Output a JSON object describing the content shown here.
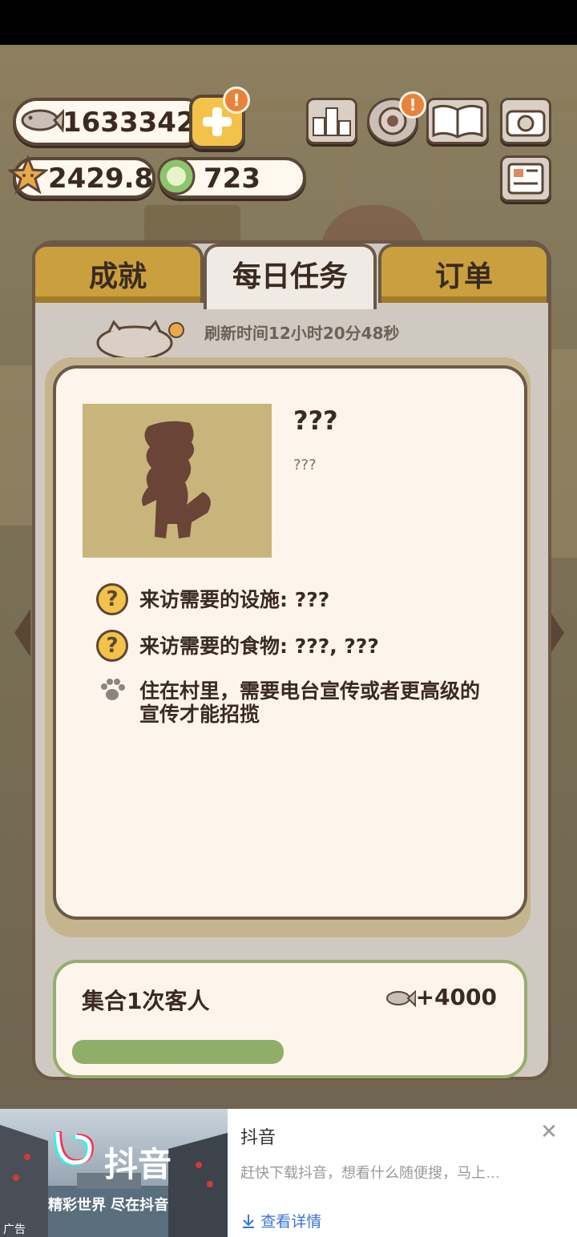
{
  "resources": {
    "fish": "1633342",
    "stars": "2429.8",
    "gems": "723"
  },
  "alerts": {
    "plus_badge": "!",
    "gear_badge": "!"
  },
  "tabs": [
    {
      "label": "成就"
    },
    {
      "label": "每日任务"
    },
    {
      "label": "订单"
    }
  ],
  "refresh_text": "刷新时间12小时20分48秒",
  "visitor": {
    "name": "???",
    "description": "???",
    "requirements": [
      {
        "icon": "question-icon",
        "text": "来访需要的设施: ???"
      },
      {
        "icon": "question-icon",
        "text": "来访需要的食物: ???, ???"
      },
      {
        "icon": "paw-icon",
        "text": "住在村里，需要电台宣传或者更高级的宣传才能招揽"
      }
    ]
  },
  "task": {
    "title": "集合1次客人",
    "reward": "+4000"
  },
  "ad": {
    "title": "抖音",
    "description": "赶快下载抖音，想看什么随便搜，马上…",
    "link_label": "查看详情",
    "tag": "广告",
    "banner_text": "抖音",
    "banner_slogan": "精彩世界 尽在抖音"
  },
  "colors": {
    "tab_active": "#efeae3",
    "tab_inactive": "#c9a03d",
    "popup_bg": "#fdf5ec",
    "task_border": "#95ae6d",
    "link": "#3a73d6"
  }
}
